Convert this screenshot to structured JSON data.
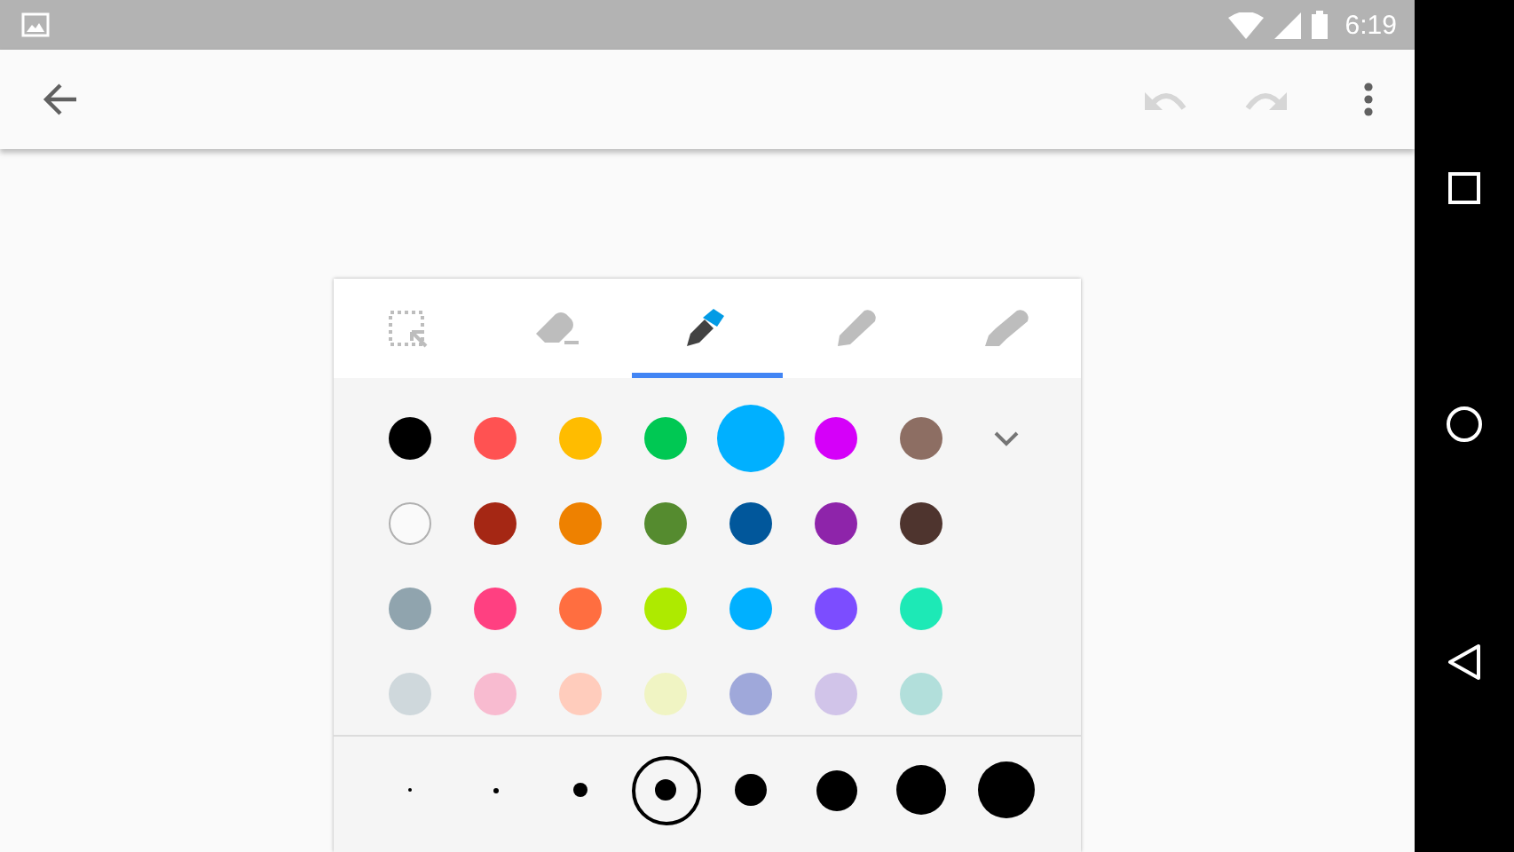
{
  "status_bar": {
    "time": "6:19"
  },
  "toolbar": {
    "undo": {
      "disabled": true
    },
    "redo": {
      "disabled": true
    }
  },
  "tools": [
    {
      "kind": "select",
      "selected": false
    },
    {
      "kind": "eraser",
      "selected": false
    },
    {
      "kind": "pen",
      "selected": true
    },
    {
      "kind": "pencil",
      "selected": false
    },
    {
      "kind": "highlighter",
      "selected": false
    }
  ],
  "colors": [
    {
      "color": "#000000",
      "selected": false
    },
    {
      "color": "#ff5252",
      "selected": false
    },
    {
      "color": "#ffbc00",
      "selected": false
    },
    {
      "color": "#00c853",
      "selected": false
    },
    {
      "color": "#00b0ff",
      "selected": true
    },
    {
      "color": "#d500f9",
      "selected": false
    },
    {
      "color": "#8d6e63",
      "selected": false
    },
    {
      "color": "#fafafa",
      "selected": false
    },
    {
      "color": "#a52714",
      "selected": false
    },
    {
      "color": "#ee8100",
      "selected": false
    },
    {
      "color": "#558b2f",
      "selected": false
    },
    {
      "color": "#01579b",
      "selected": false
    },
    {
      "color": "#8e24aa",
      "selected": false
    },
    {
      "color": "#4e342e",
      "selected": false
    },
    {
      "color": "#90a4ae",
      "selected": false
    },
    {
      "color": "#ff4081",
      "selected": false
    },
    {
      "color": "#ff6e40",
      "selected": false
    },
    {
      "color": "#aeea00",
      "selected": false
    },
    {
      "color": "#00b0ff",
      "selected": false
    },
    {
      "color": "#7c4dff",
      "selected": false
    },
    {
      "color": "#1de9b6",
      "selected": false
    },
    {
      "color": "#cfd8dc",
      "selected": false
    },
    {
      "color": "#f8bbd0",
      "selected": false
    },
    {
      "color": "#ffccbc",
      "selected": false
    },
    {
      "color": "#f0f4c3",
      "selected": false
    },
    {
      "color": "#9fa8da",
      "selected": false
    },
    {
      "color": "#d1c4e9",
      "selected": false
    },
    {
      "color": "#b2dfdb",
      "selected": false
    }
  ],
  "sizes": [
    {
      "selected": false
    },
    {
      "selected": false
    },
    {
      "selected": false
    },
    {
      "selected": true
    },
    {
      "selected": false
    },
    {
      "selected": false
    },
    {
      "selected": false
    },
    {
      "selected": false
    }
  ]
}
